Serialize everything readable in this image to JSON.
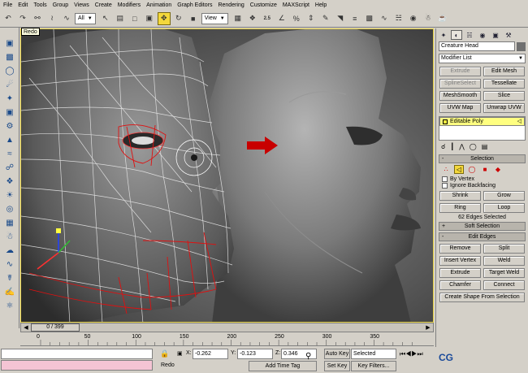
{
  "menu": [
    "File",
    "Edit",
    "Tools",
    "Group",
    "Views",
    "Create",
    "Modifiers",
    "Animation",
    "Graph Editors",
    "Rendering",
    "Customize",
    "MAXScript",
    "Help"
  ],
  "toolbar": {
    "undo_icon": "undo-arrow-icon",
    "redo_icon": "redo-arrow-icon",
    "selection_filter": "All",
    "ref_coord": "View",
    "snap_value": "2.5"
  },
  "tooltip": "Redo",
  "viewport": {
    "border_color": "#e8d44a",
    "arrow_color": "#c80000"
  },
  "timeslider": {
    "thumb": "0 / 399",
    "current": 0,
    "total": 399
  },
  "trackbar_ticks": [
    "0",
    "50",
    "100",
    "150",
    "200",
    "250",
    "300",
    "350"
  ],
  "status": {
    "prompt": "Redo",
    "x_label": "X:",
    "x": "-0.262",
    "y_label": "Y:",
    "y": "-0.123",
    "z_label": "Z:",
    "z": "0.346",
    "add_time_tag": "Add Time Tag",
    "auto_key": "Auto Key",
    "set_key": "Set Key",
    "key_mode": "Selected",
    "key_filters": "Key Filters..."
  },
  "cmd_panel": {
    "object_name": "Creature Head",
    "modifier_list": "Modifier List",
    "mod_buttons": [
      {
        "label": "Extrude",
        "enabled": false
      },
      {
        "label": "Edit Mesh",
        "enabled": true
      },
      {
        "label": "SplineSelect",
        "enabled": false
      },
      {
        "label": "Tessellate",
        "enabled": true
      },
      {
        "label": "MeshSmooth",
        "enabled": true
      },
      {
        "label": "Slice",
        "enabled": true
      },
      {
        "label": "UVW Map",
        "enabled": true
      },
      {
        "label": "Unwrap UVW",
        "enabled": true
      }
    ],
    "stack_item": "Editable Poly",
    "selection_rollout": "Selection",
    "by_vertex": "By Vertex",
    "ignore_backfacing": "Ignore Backfacing",
    "shrink": "Shrink",
    "grow": "Grow",
    "ring": "Ring",
    "loop": "Loop",
    "selection_info": "62 Edges Selected",
    "soft_selection_rollout": "Soft Selection",
    "edit_edges_rollout": "Edit Edges",
    "remove": "Remove",
    "split": "Split",
    "insert_vertex": "Insert Vertex",
    "weld": "Weld",
    "extrude": "Extrude",
    "target_weld": "Target Weld",
    "chamfer": "Chamfer",
    "connect": "Connect",
    "create_shape": "Create Shape From Selection"
  }
}
